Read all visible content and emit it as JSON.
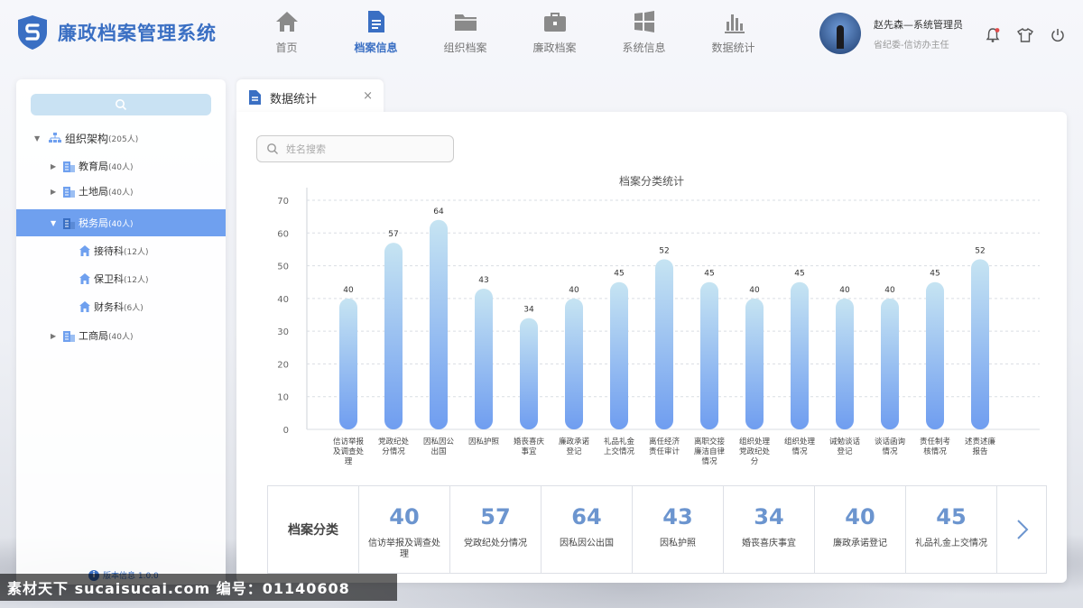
{
  "app": {
    "title": "廉政档案管理系统"
  },
  "nav": [
    {
      "label": "首页",
      "icon": "home-icon"
    },
    {
      "label": "档案信息",
      "icon": "document-icon",
      "active": true
    },
    {
      "label": "组织档案",
      "icon": "folder-icon"
    },
    {
      "label": "廉政档案",
      "icon": "briefcase-icon"
    },
    {
      "label": "系统信息",
      "icon": "windows-icon"
    },
    {
      "label": "数据统计",
      "icon": "bar-chart-icon"
    }
  ],
  "user": {
    "name": "赵先森—系统管理员",
    "role": "省纪委-信访办主任"
  },
  "tree": {
    "root": {
      "label": "组织架构",
      "count": "(205人)"
    },
    "nodes": [
      {
        "label": "教育局",
        "count": "(40人)"
      },
      {
        "label": "土地局",
        "count": "(40人)"
      },
      {
        "label": "税务局",
        "count": "(40人)"
      },
      {
        "label": "接待科",
        "count": "(12人)"
      },
      {
        "label": "保卫科",
        "count": "(12人)"
      },
      {
        "label": "财务科",
        "count": "(6人)"
      },
      {
        "label": "工商局",
        "count": "(40人)"
      }
    ]
  },
  "version": "版本信息 1.0.0",
  "tab": {
    "label": "数据统计",
    "close": "×"
  },
  "search": {
    "placeholder": "姓名搜索"
  },
  "chart_data": {
    "type": "bar",
    "title": "档案分类统计",
    "categories": [
      "信访举报及调查处理",
      "党政纪处分情况",
      "因私因公出国",
      "因私护照",
      "婚丧喜庆事宜",
      "廉政承诺登记",
      "礼品礼金上交情况",
      "离任经济责任审计",
      "离职交接廉洁自律情况",
      "组织处理党政纪处分",
      "组织处理情况",
      "诫勉谈话登记",
      "谈话函询情况",
      "责任制考核情况",
      "述责述廉报告"
    ],
    "values": [
      40,
      57,
      64,
      43,
      34,
      40,
      45,
      52,
      45,
      40,
      45,
      40,
      40,
      45,
      52
    ],
    "ylim": [
      0,
      70
    ],
    "yticks": [
      0,
      10,
      20,
      30,
      40,
      50,
      60,
      70
    ],
    "grid": true,
    "colors": {
      "bar_top": "#c6e4f2",
      "bar_bottom": "#6f9df0",
      "grid": "#d9dde3"
    }
  },
  "summary": {
    "header": "档案分类",
    "cells": [
      {
        "value": "40",
        "label": "信访举报及调查处理"
      },
      {
        "value": "57",
        "label": "党政纪处分情况"
      },
      {
        "value": "64",
        "label": "因私因公出国"
      },
      {
        "value": "43",
        "label": "因私护照"
      },
      {
        "value": "34",
        "label": "婚丧喜庆事宜"
      },
      {
        "value": "40",
        "label": "廉政承诺登记"
      },
      {
        "value": "45",
        "label": "礼品礼金上交情况"
      }
    ]
  },
  "watermark": "素材天下 sucaisucai.com    编号：01140608",
  "colors": {
    "accent": "#3a6fc3",
    "selected": "#6fa0ef",
    "value": "#6c95cf"
  }
}
